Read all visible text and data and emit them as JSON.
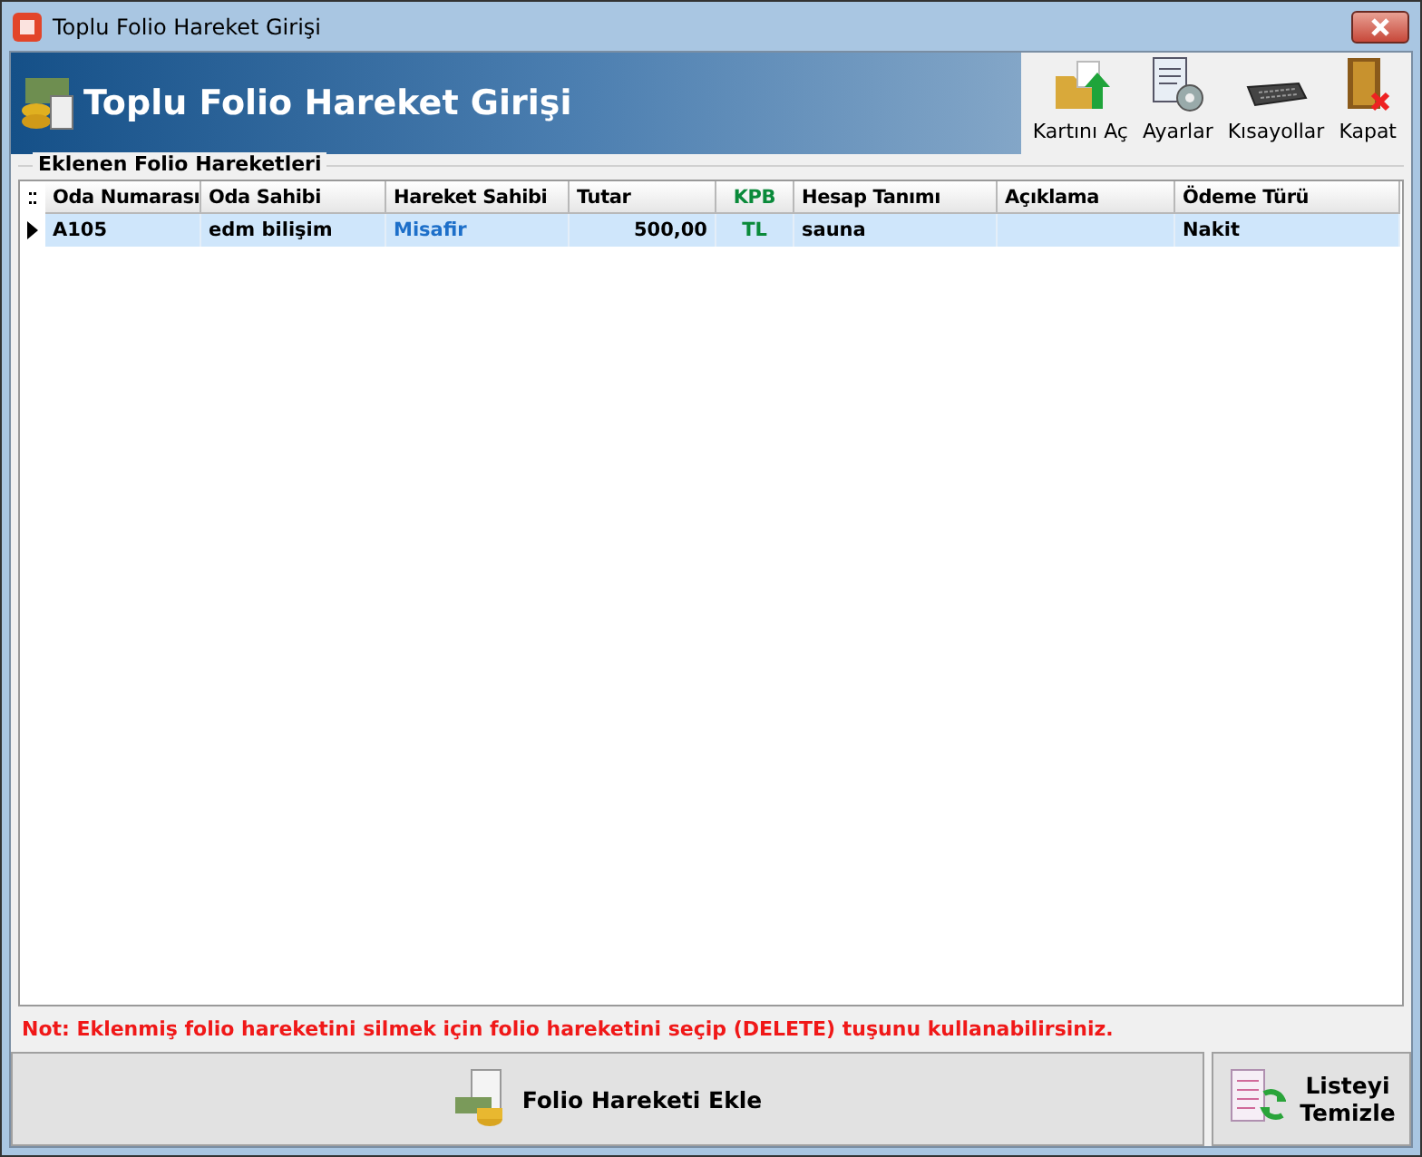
{
  "window": {
    "title": "Toplu Folio Hareket Girişi"
  },
  "header": {
    "title": "Toplu Folio Hareket Girişi"
  },
  "toolbar": [
    {
      "label": "Kartını Aç",
      "kind": "open"
    },
    {
      "label": "Ayarlar",
      "kind": "settings"
    },
    {
      "label": "Kısayollar",
      "kind": "keyboard"
    },
    {
      "label": "Kapat",
      "kind": "exit"
    }
  ],
  "group": {
    "title": "Eklenen Folio Hareketleri"
  },
  "table": {
    "columns": [
      {
        "label": "Oda Numarası",
        "kind": "text"
      },
      {
        "label": "Oda Sahibi",
        "kind": "text"
      },
      {
        "label": "Hareket Sahibi",
        "kind": "link"
      },
      {
        "label": "Tutar",
        "kind": "number"
      },
      {
        "label": "KPB",
        "kind": "code"
      },
      {
        "label": "Hesap Tanımı",
        "kind": "text"
      },
      {
        "label": "Açıklama",
        "kind": "text"
      },
      {
        "label": "Ödeme Türü",
        "kind": "text"
      }
    ],
    "rows": [
      {
        "selected": true,
        "cells": [
          "A105",
          "edm bilişim",
          "Misafir",
          "500,00",
          "TL",
          "sauna",
          "",
          "Nakit"
        ]
      }
    ]
  },
  "note": "Not: Eklenmiş folio hareketini silmek için folio hareketini seçip (DELETE) tuşunu kullanabilirsiniz.",
  "buttons": [
    {
      "label": "Folio Hareketi Ekle",
      "kind": "add"
    },
    {
      "label": "Listeyi\nTemizle",
      "kind": "clear"
    }
  ]
}
